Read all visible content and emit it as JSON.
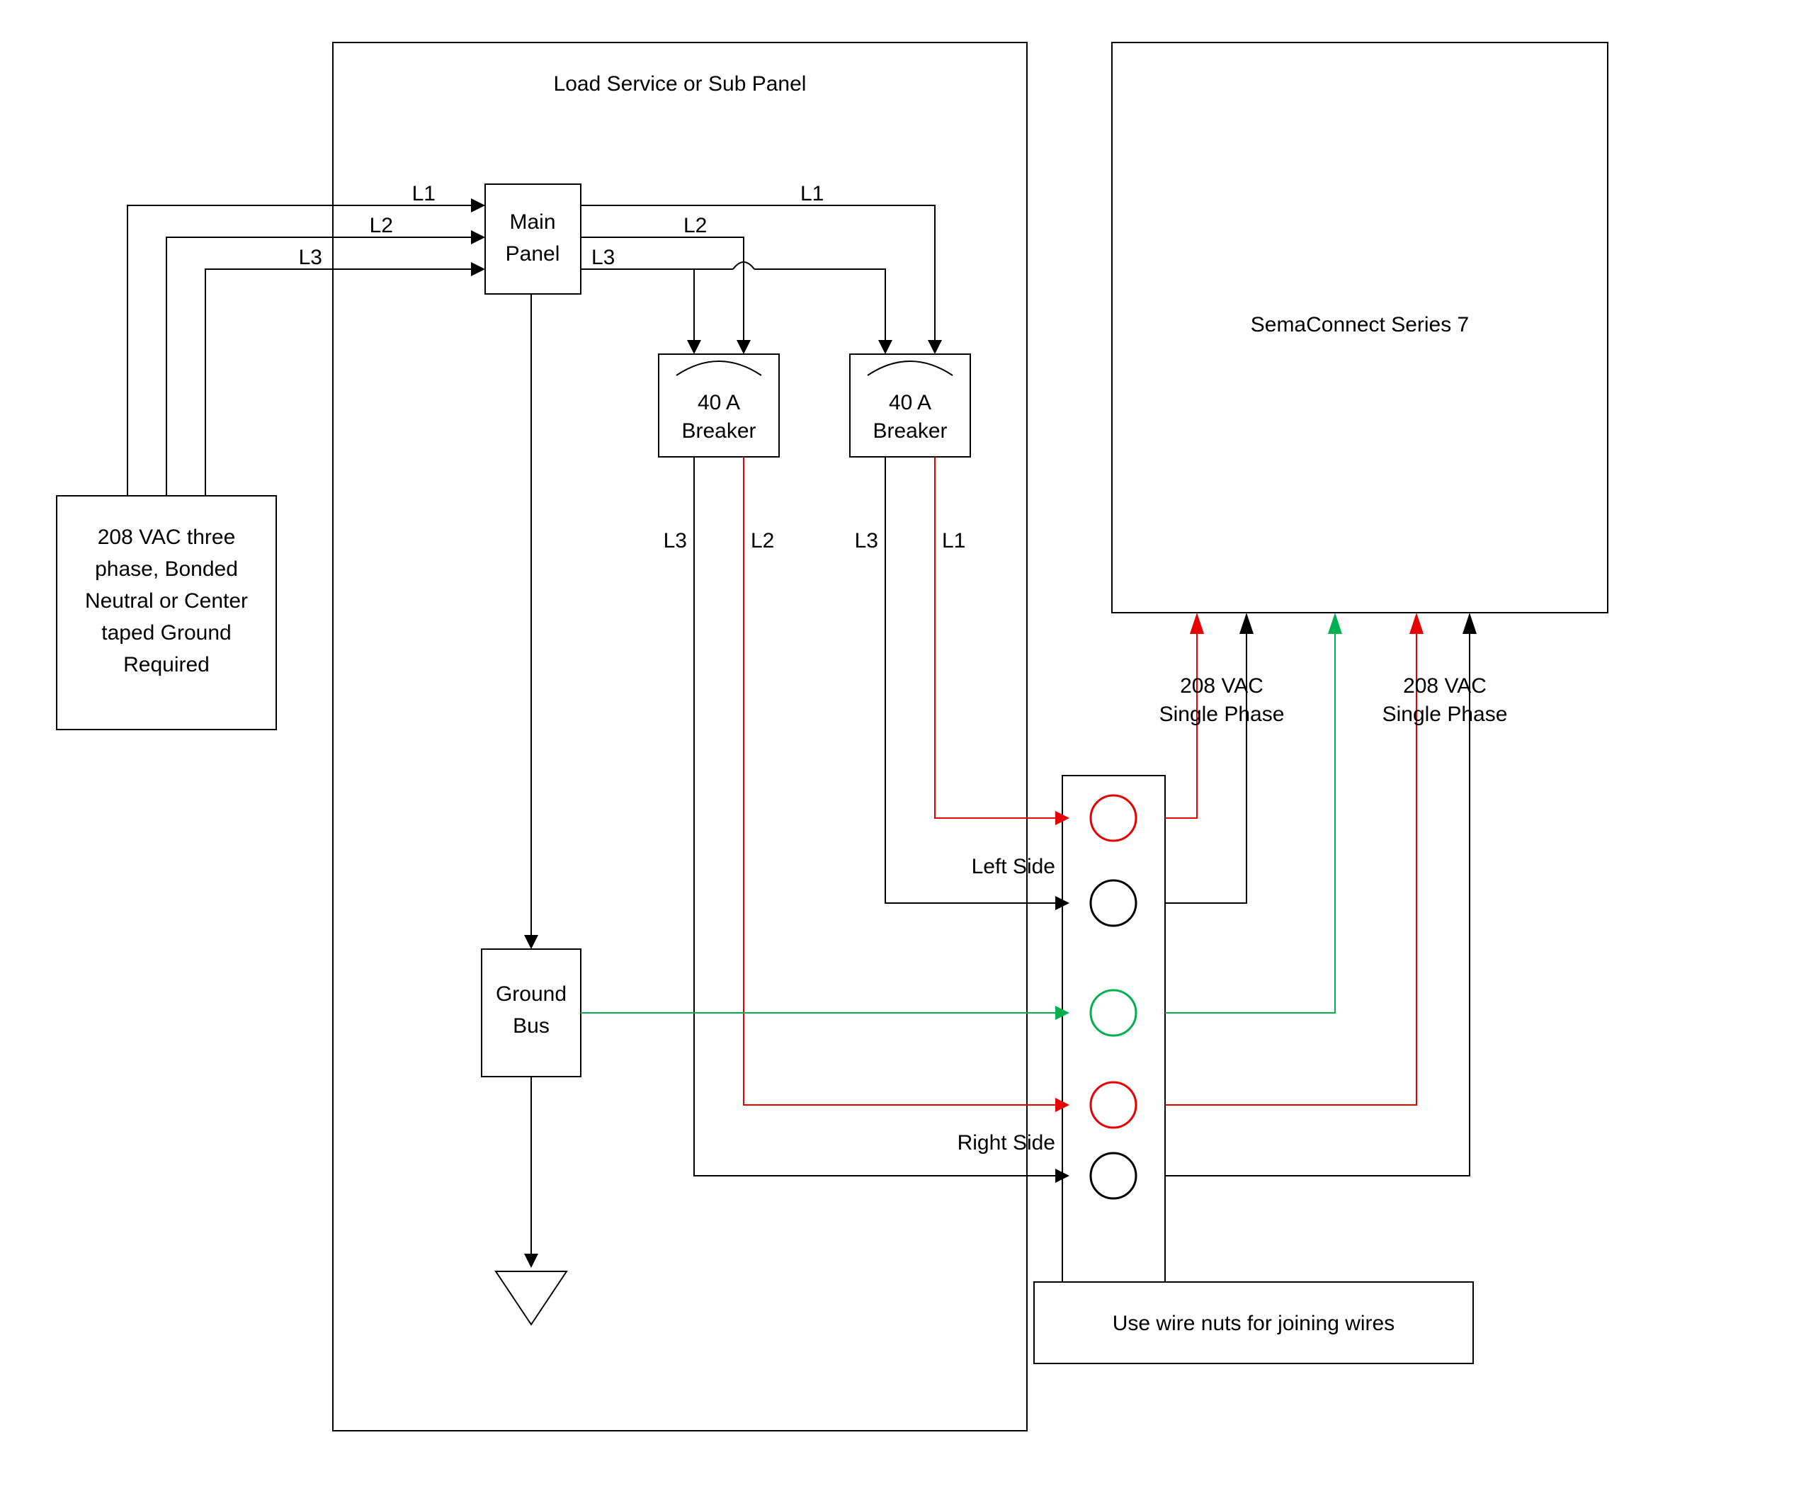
{
  "panel_title": "Load Service or Sub Panel",
  "supply": {
    "l1": "208 VAC three",
    "l2": "phase, Bonded",
    "l3": "Neutral or Center",
    "l4": "taped Ground",
    "l5": "Required"
  },
  "main_panel": {
    "l1": "Main",
    "l2": "Panel"
  },
  "phases": {
    "L1": "L1",
    "L2": "L2",
    "L3": "L3"
  },
  "breaker": {
    "l1": "40 A",
    "l2": "Breaker"
  },
  "breaker_out_left": {
    "a": "L3",
    "b": "L2"
  },
  "breaker_out_right": {
    "a": "L3",
    "b": "L1"
  },
  "ground_bus": {
    "l1": "Ground",
    "l2": "Bus"
  },
  "left_side": "Left Side",
  "right_side": "Right Side",
  "sema": "SemaConnect Series 7",
  "vac": {
    "l1": "208 VAC",
    "l2": "Single Phase"
  },
  "wire_nuts": "Use wire nuts for joining wires"
}
